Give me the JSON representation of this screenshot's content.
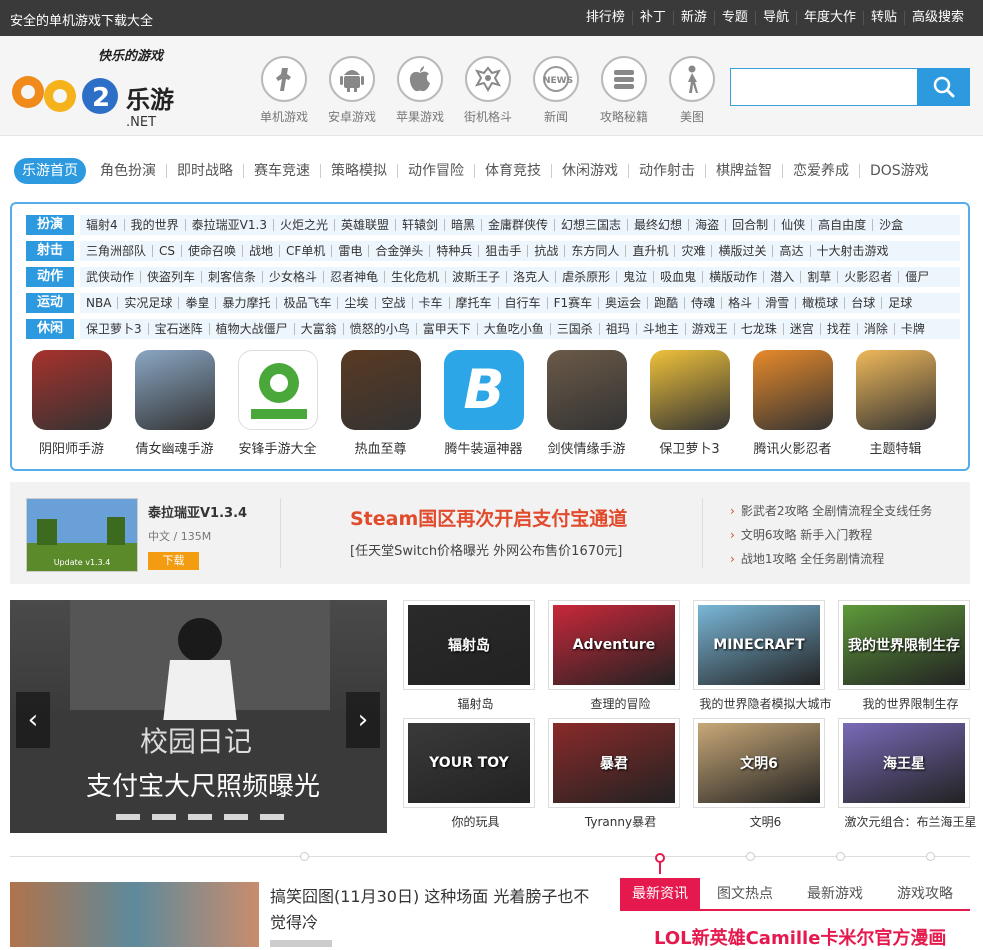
{
  "topbar": {
    "slogan": "安全的单机游戏下载大全",
    "links": [
      "排行榜",
      "补丁",
      "新游",
      "专题",
      "导航",
      "年度大作",
      "转贴",
      "高级搜索"
    ]
  },
  "logo": {
    "brand_top": "快乐的游戏",
    "brand_num": "962",
    "brand_cn": "乐游",
    "brand_net": ".NET"
  },
  "nav_icons": [
    {
      "label": "单机游戏",
      "icon": "cs-soldier-icon"
    },
    {
      "label": "安卓游戏",
      "icon": "android-icon"
    },
    {
      "label": "苹果游戏",
      "icon": "apple-icon"
    },
    {
      "label": "街机格斗",
      "icon": "arcade-icon"
    },
    {
      "label": "新闻",
      "icon": "news-icon"
    },
    {
      "label": "攻略秘籍",
      "icon": "guide-icon"
    },
    {
      "label": "美图",
      "icon": "girl-icon"
    }
  ],
  "search": {
    "placeholder": "",
    "button_icon": "search-icon"
  },
  "categories": [
    "乐游首页",
    "角色扮演",
    "即时战略",
    "赛车竞速",
    "策略模拟",
    "动作冒险",
    "体育竞技",
    "休闲游戏",
    "动作射击",
    "棋牌益智",
    "恋爱养成",
    "DOS游戏"
  ],
  "tag_rows": [
    {
      "label": "扮演",
      "items": [
        "辐射4",
        "我的世界",
        "泰拉瑞亚V1.3",
        "火炬之光",
        "英雄联盟",
        "轩辕剑",
        "暗黑",
        "金庸群侠传",
        "幻想三国志",
        "最终幻想",
        "海盗",
        "回合制",
        "仙侠",
        "高自由度",
        "沙盒"
      ]
    },
    {
      "label": "射击",
      "items": [
        "三角洲部队",
        "CS",
        "使命召唤",
        "战地",
        "CF单机",
        "雷电",
        "合金弹头",
        "特种兵",
        "狙击手",
        "抗战",
        "东方同人",
        "直升机",
        "灾难",
        "横版过关",
        "高达",
        "十大射击游戏"
      ]
    },
    {
      "label": "动作",
      "items": [
        "武侠动作",
        "侠盗列车",
        "刺客信条",
        "少女格斗",
        "忍者神龟",
        "生化危机",
        "波斯王子",
        "洛克人",
        "虐杀原形",
        "鬼泣",
        "吸血鬼",
        "横版动作",
        "潜入",
        "割草",
        "火影忍者",
        "僵尸"
      ]
    },
    {
      "label": "运动",
      "items": [
        "NBA",
        "实况足球",
        "拳皇",
        "暴力摩托",
        "极品飞车",
        "尘埃",
        "空战",
        "卡车",
        "摩托车",
        "自行车",
        "F1赛车",
        "奥运会",
        "跑酷",
        "侍魂",
        "格斗",
        "滑雪",
        "橄榄球",
        "台球",
        "足球"
      ]
    },
    {
      "label": "休闲",
      "items": [
        "保卫萝卜3",
        "宝石迷阵",
        "植物大战僵尸",
        "大富翁",
        "愤怒的小鸟",
        "富甲天下",
        "大鱼吃小鱼",
        "三国杀",
        "祖玛",
        "斗地主",
        "游戏王",
        "七龙珠",
        "迷宫",
        "找茬",
        "消除",
        "卡牌"
      ]
    }
  ],
  "apps": [
    {
      "name": "阴阳师手游",
      "color": "#a8322c"
    },
    {
      "name": "倩女幽魂手游",
      "color": "#8aa7c4"
    },
    {
      "name": "安锋手游大全",
      "color": "#4aa83a"
    },
    {
      "name": "热血至尊",
      "color": "#5a3a22"
    },
    {
      "name": "腾牛装逼神器",
      "color": "#2da6e8"
    },
    {
      "name": "剑侠情缘手游",
      "color": "#6b5a48"
    },
    {
      "name": "保卫萝卜3",
      "color": "#f0c23a"
    },
    {
      "name": "腾讯火影忍者",
      "color": "#e88a2a"
    },
    {
      "name": "主题特辑",
      "color": "#f0b95a"
    }
  ],
  "feature": {
    "game_title": "泰拉瑞亚V1.3.4",
    "game_meta": "中文 / 135M",
    "download": "下载",
    "thumb_text": "Update v1.3.4",
    "headline": "Steam国区再次开启支付宝通道",
    "subline": "[任天堂Switch价格曝光 外网公布售价1670元]",
    "news": [
      "影武者2攻略 全剧情流程全支线任务",
      "文明6攻略 新手入门教程",
      "战地1攻略 全任务剧情流程"
    ]
  },
  "carousel": {
    "line1": "校园日记",
    "line2": "支付宝大尺照频曝光",
    "prev": "‹",
    "next": "›"
  },
  "game_grid": [
    {
      "name": "辐射岛",
      "overlay": "辐射岛",
      "color": "#2a2a2a"
    },
    {
      "name": "查理的冒险",
      "overlay": "Adventure",
      "color": "#c8283a"
    },
    {
      "name": "我的世界隐者模拟大城市",
      "overlay": "MINECRAFT",
      "color": "#7ab7d8"
    },
    {
      "name": "我的世界限制生存",
      "overlay": "我的世界限制生存",
      "color": "#5e9a3a"
    },
    {
      "name": "你的玩具",
      "overlay": "YOUR TOY",
      "color": "#3a3a3a"
    },
    {
      "name": "Tyranny暴君",
      "overlay": "暴君",
      "color": "#8a2a2a"
    },
    {
      "name": "文明6",
      "overlay": "文明6",
      "color": "#c8a878"
    },
    {
      "name": "激次元组合：布兰海王星",
      "overlay": "海王星",
      "color": "#7a6ab8"
    }
  ],
  "news_item": {
    "title": "搞笑囧图(11月30日) 这种场面 光着膀子也不觉得冷"
  },
  "tabs": [
    "最新资讯",
    "图文热点",
    "最新游戏",
    "游戏攻略"
  ],
  "lol_headline": "LOL新英雄Camille卡米尔官方漫画"
}
